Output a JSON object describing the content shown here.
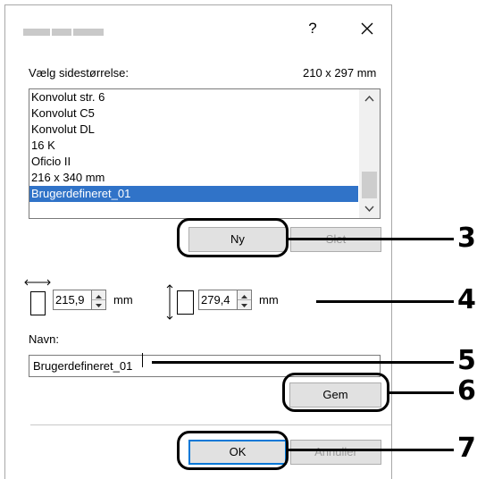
{
  "window": {
    "help_label": "?",
    "close_icon": "close-icon"
  },
  "page_size": {
    "label": "Vælg sidestørrelse:",
    "current_size": "210 x 297 mm",
    "options": [
      "Konvolut str. 6",
      "Konvolut C5",
      "Konvolut DL",
      "16 K",
      "Oficio II",
      "216 x 340 mm",
      "Brugerdefineret_01"
    ],
    "selected": "Brugerdefineret_01"
  },
  "buttons": {
    "new_label": "Ny",
    "delete_label": "Slet",
    "save_label": "Gem",
    "ok_label": "OK",
    "cancel_label": "Annuller"
  },
  "dimensions": {
    "width_value": "215,9",
    "width_unit": "mm",
    "height_value": "279,4",
    "height_unit": "mm"
  },
  "name_field": {
    "label": "Navn:",
    "value": "Brugerdefineret_01"
  },
  "callouts": [
    "3",
    "4",
    "5",
    "6",
    "7"
  ],
  "colors": {
    "selection": "#3073c8",
    "button_face": "#e1e1e1",
    "focus_border": "#0078d7"
  }
}
